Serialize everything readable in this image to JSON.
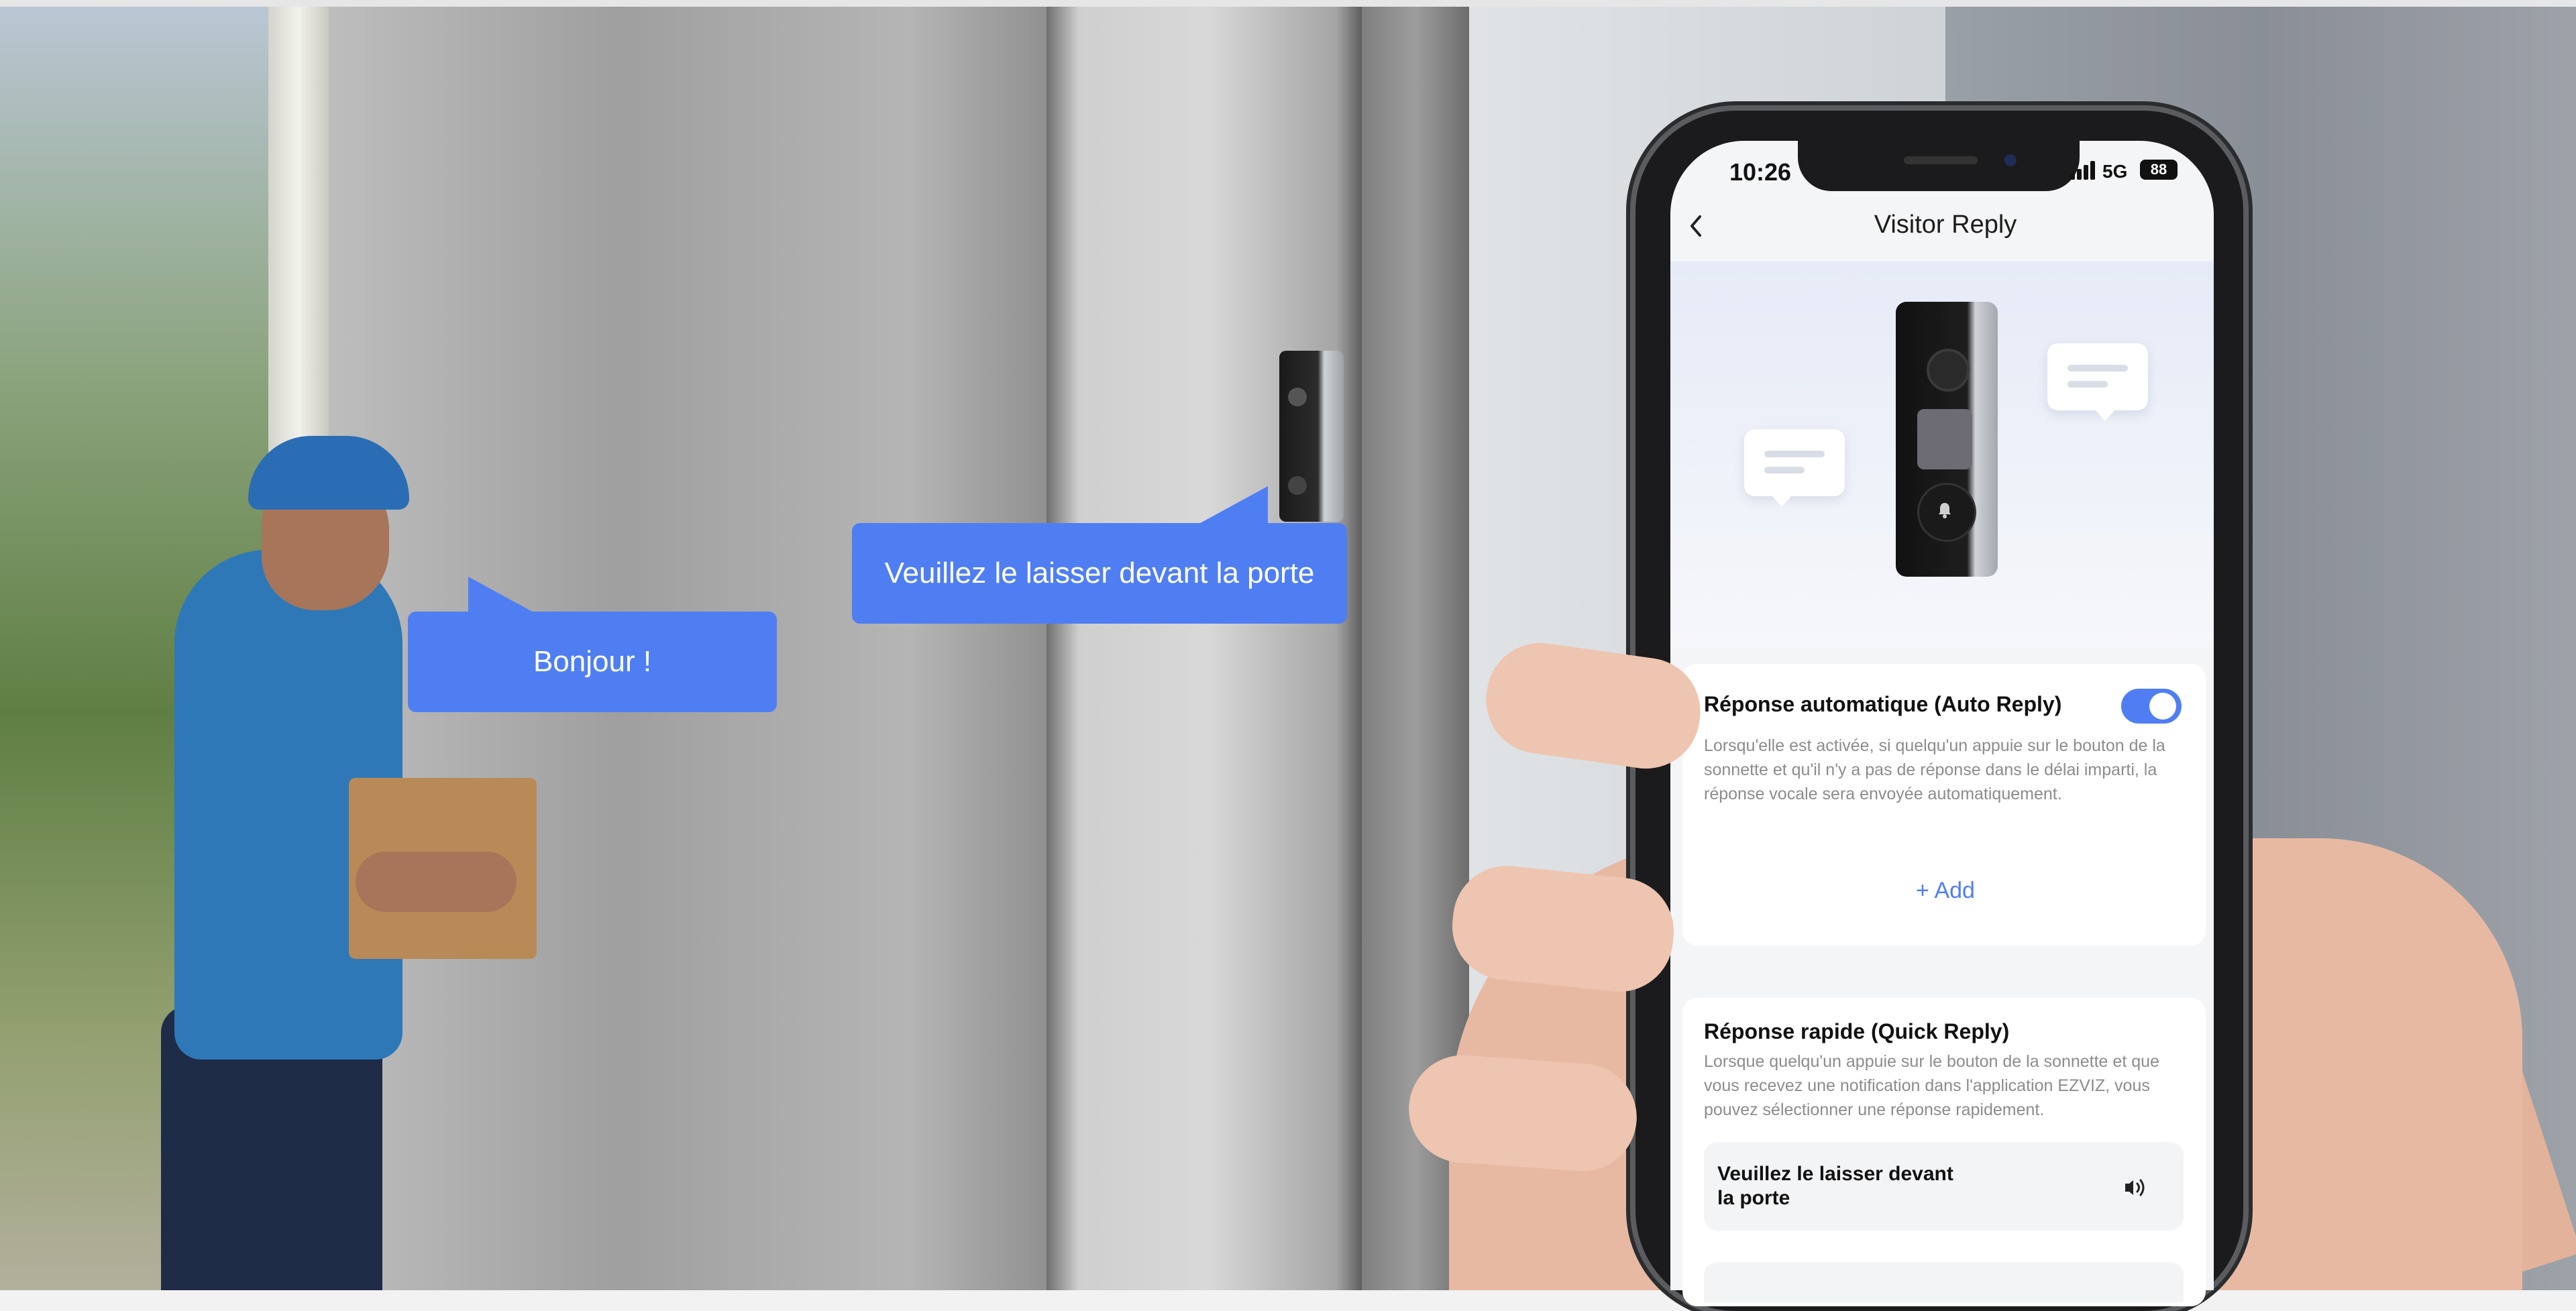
{
  "scene": {
    "bubble_hello": "Bonjour !",
    "bubble_porte": "Veuillez le laisser devant la porte"
  },
  "status_bar": {
    "time": "10:26",
    "network": "5G",
    "battery": "88"
  },
  "nav": {
    "title": "Visitor Reply"
  },
  "auto_reply": {
    "title": "Réponse automatique (Auto Reply)",
    "description": "Lorsqu'elle est activée, si quelqu'un appuie sur le bouton de la sonnette et qu'il n'y a pas de réponse dans le délai imparti, la réponse vocale sera envoyée automatiquement.",
    "enabled": true,
    "add_label": "+ Add"
  },
  "quick_reply": {
    "title": "Réponse rapide (Quick Reply)",
    "description": "Lorsque quelqu'un appuie sur le bouton de la sonnette et que vous recevez une notification dans l'application EZVIZ, vous pouvez sélectionner une réponse rapidement.",
    "items": [
      {
        "label": "Veuillez le laisser devant la porte"
      }
    ]
  },
  "colors": {
    "accent": "#4f7ef3",
    "bubble": "#4f7ef3"
  },
  "icons": {
    "back": "chevron-left-icon",
    "speaker": "speaker-icon",
    "bell": "bell-icon"
  }
}
